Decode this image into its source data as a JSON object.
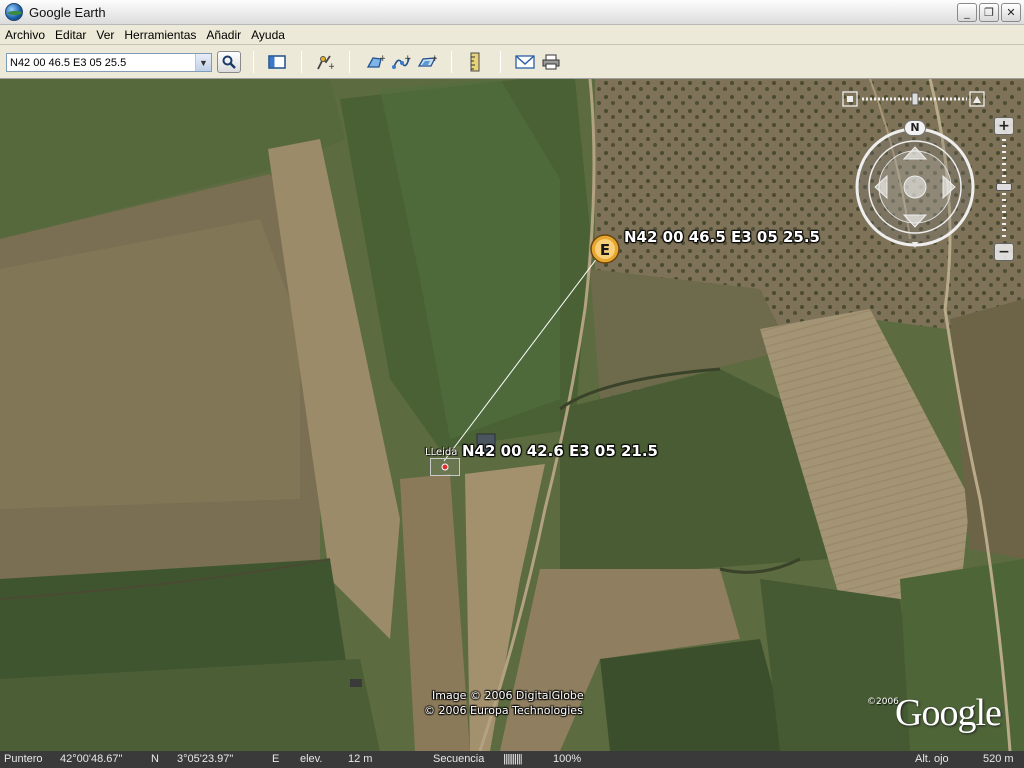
{
  "window": {
    "title": "Google Earth",
    "minimize": "_",
    "maximize": "❐",
    "close": "✕"
  },
  "menu": [
    "Archivo",
    "Editar",
    "Ver",
    "Herramientas",
    "Añadir",
    "Ayuda"
  ],
  "toolbar": {
    "search_value": "N42 00 46.5 E3 05 25.5",
    "icons": [
      "sidebar-toggle-icon",
      "add-placemark-icon",
      "add-polygon-icon",
      "add-path-icon",
      "add-image-overlay-icon",
      "ruler-icon",
      "email-icon",
      "print-icon"
    ]
  },
  "map": {
    "placemark_e": {
      "icon_letter": "E",
      "label": "N42 00 46.5 E3 05 25.5"
    },
    "placemark_lleida": {
      "small_label": "LLeida",
      "label": "N42 00 42.6 E3 05 21.5"
    },
    "copyright_line1": "Image © 2006 DigitalGlobe",
    "copyright_line2": "© 2006 Europa Technologies",
    "logo_year": "©2006",
    "logo_text": "Google",
    "compass_north": "N",
    "zoom_in": "+",
    "zoom_out": "−"
  },
  "status": {
    "pointer_label": "Puntero",
    "latitude": "42°00'48.67\"",
    "lat_hemi": "N",
    "longitude": "3°05'23.97\"",
    "lon_hemi": "E",
    "elev_label": "elev.",
    "elev_value": "12 m",
    "streaming_label": "Secuencia",
    "streaming_bar": "||||||||||",
    "streaming_percent": "100%",
    "eye_alt_label": "Alt. ojo",
    "eye_alt_value": "520 m"
  }
}
